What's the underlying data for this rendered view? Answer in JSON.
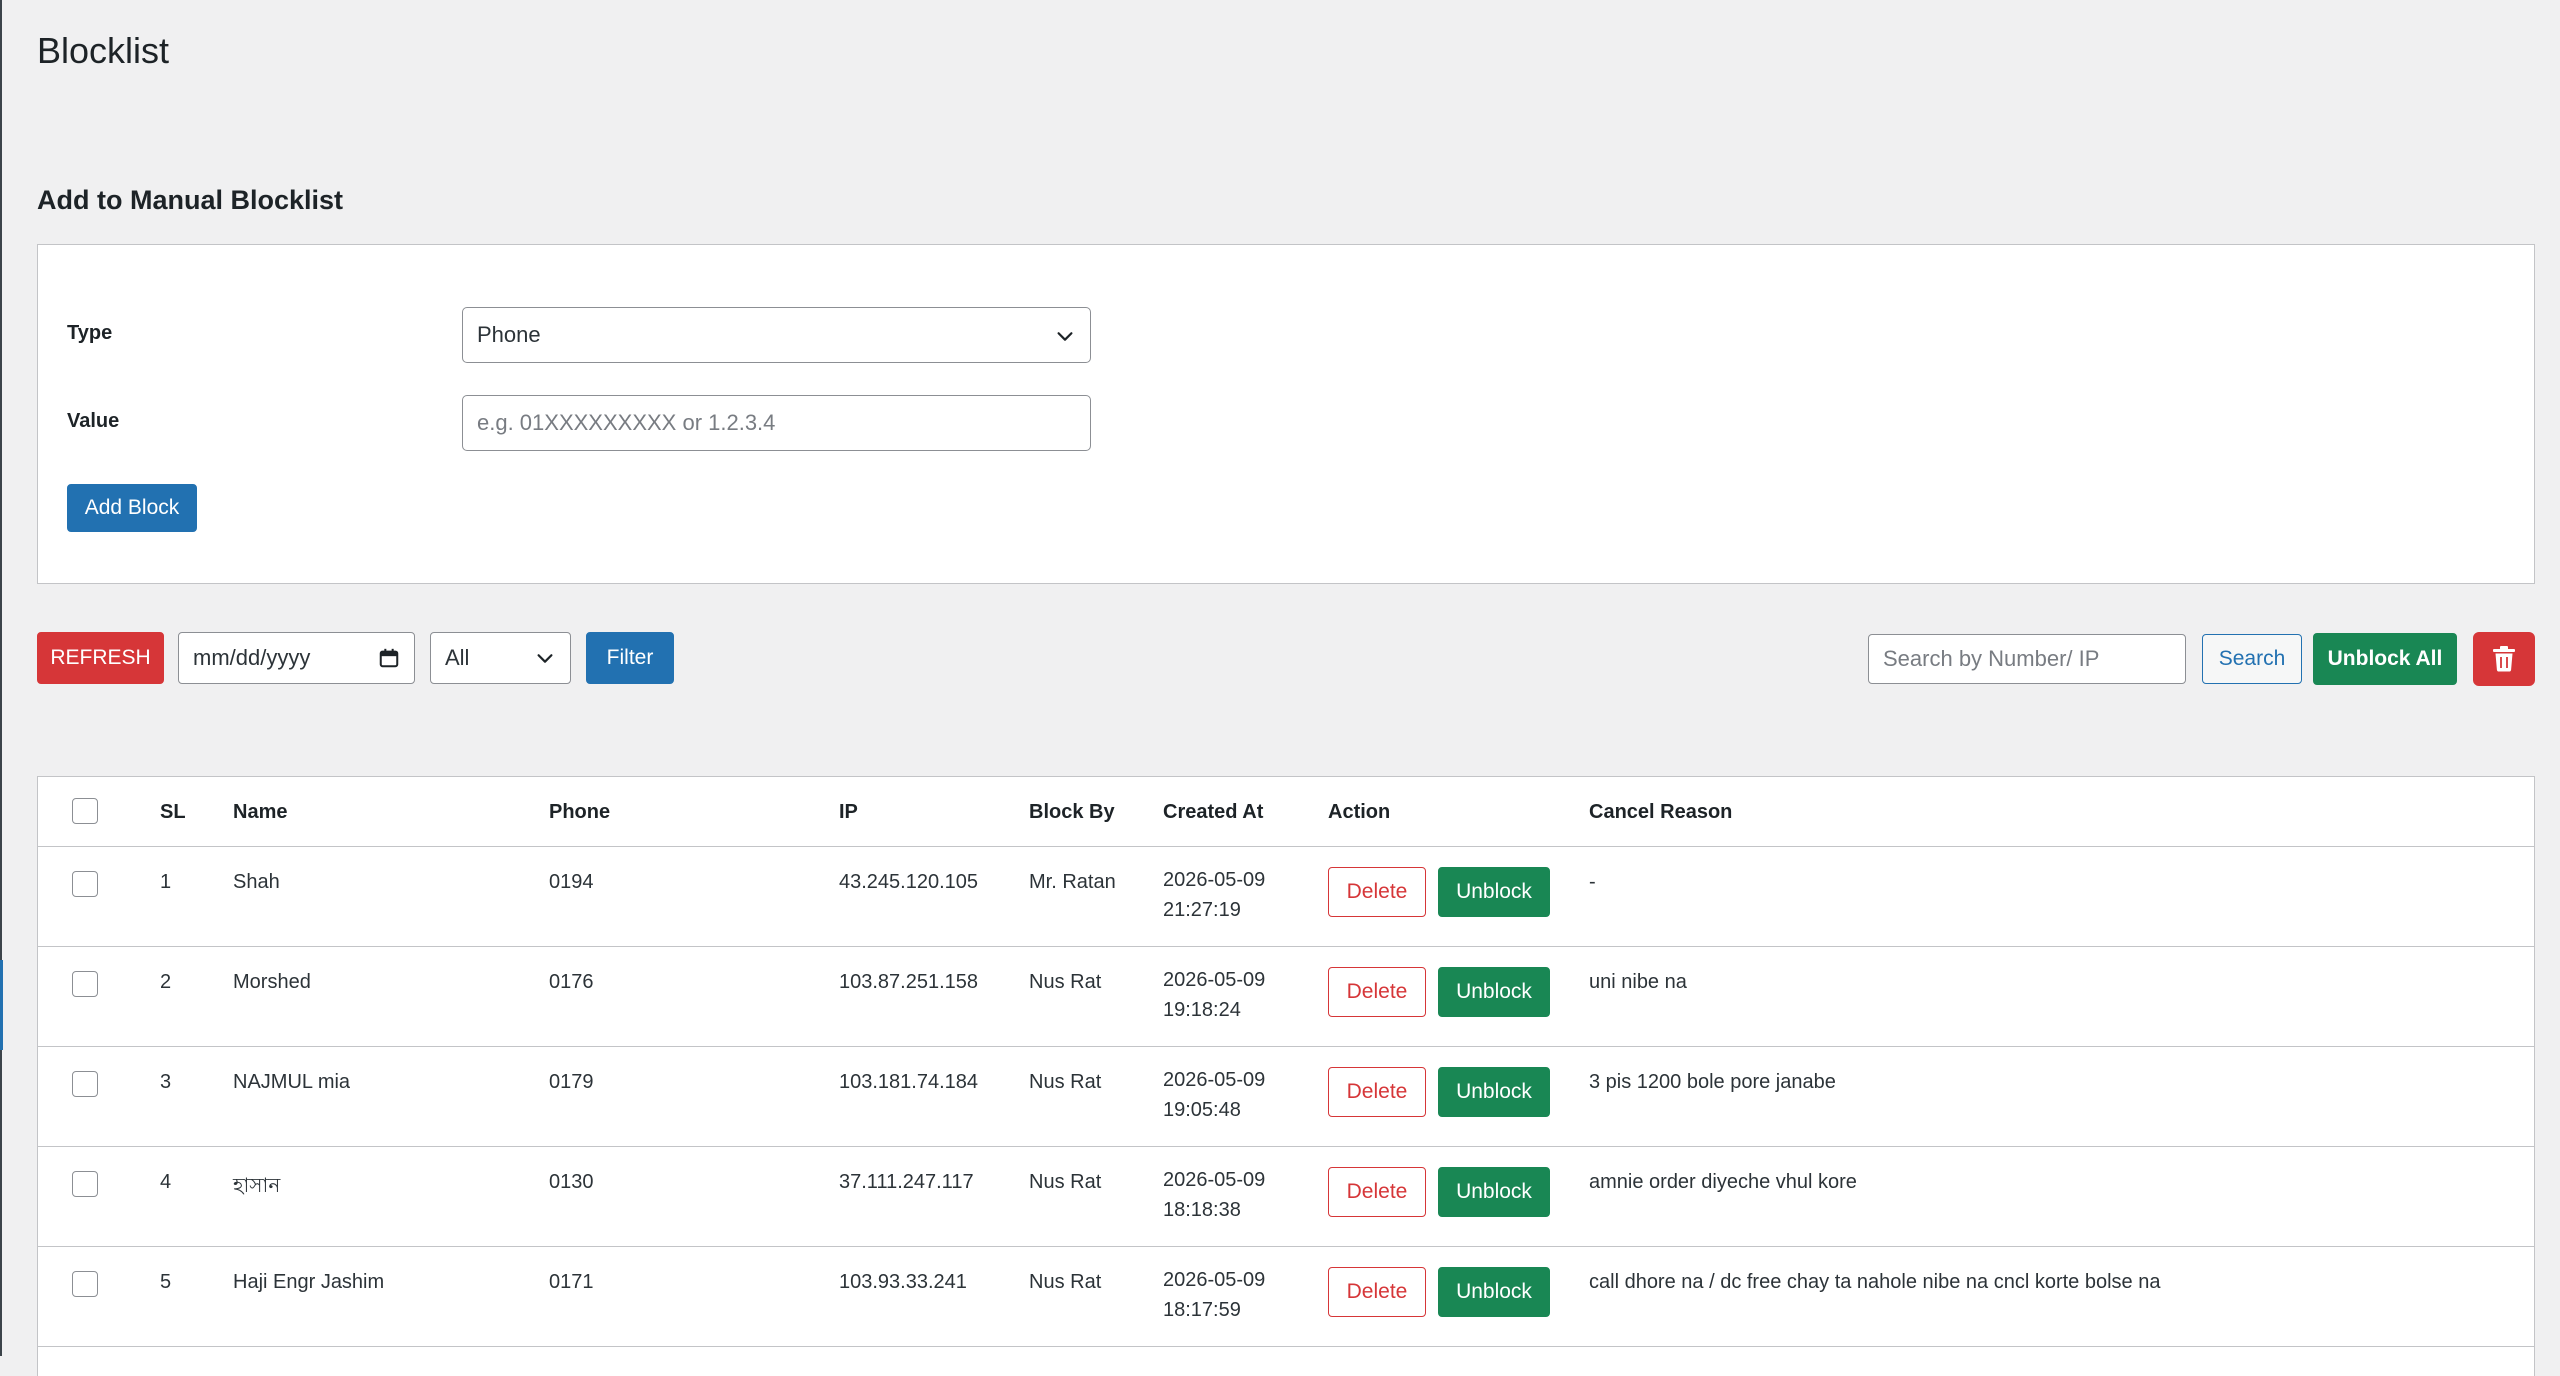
{
  "page": {
    "title": "Blocklist"
  },
  "manual": {
    "section_title": "Add to Manual Blocklist",
    "type_label": "Type",
    "type_value": "Phone",
    "value_label": "Value",
    "value_placeholder": "e.g. 01XXXXXXXXX or 1.2.3.4",
    "add_button": "Add Block"
  },
  "toolbar": {
    "refresh": "REFRESH",
    "date_placeholder": "mm/dd/yyyy",
    "status_value": "All",
    "filter": "Filter",
    "search_placeholder": "Search by Number/ IP",
    "search": "Search",
    "unblock_all": "Unblock All"
  },
  "table": {
    "headers": {
      "sl": "SL",
      "name": "Name",
      "phone": "Phone",
      "ip": "IP",
      "block_by": "Block By",
      "created_at": "Created At",
      "action": "Action",
      "cancel_reason": "Cancel Reason"
    },
    "delete_label": "Delete",
    "unblock_label": "Unblock",
    "rows": [
      {
        "sl": "1",
        "name": "Shah",
        "phone": "0194",
        "ip": "43.245.120.105",
        "block_by": "Mr. Ratan",
        "date": "2026-05-09",
        "time": "21:27:19",
        "reason": "-"
      },
      {
        "sl": "2",
        "name": "Morshed",
        "phone": "0176",
        "ip": "103.87.251.158",
        "block_by": "Nus Rat",
        "date": "2026-05-09",
        "time": "19:18:24",
        "reason": "uni nibe na"
      },
      {
        "sl": "3",
        "name": "NAJMUL mia",
        "phone": "0179",
        "ip": "103.181.74.184",
        "block_by": "Nus Rat",
        "date": "2026-05-09",
        "time": "19:05:48",
        "reason": "3 pis 1200 bole pore janabe"
      },
      {
        "sl": "4",
        "name": "হাসান",
        "phone": "0130",
        "ip": "37.111.247.117",
        "block_by": "Nus Rat",
        "date": "2026-05-09",
        "time": "18:18:38",
        "reason": "amnie order diyeche vhul kore"
      },
      {
        "sl": "5",
        "name": "Haji Engr Jashim",
        "phone": "0171",
        "ip": "103.93.33.241",
        "block_by": "Nus Rat",
        "date": "2026-05-09",
        "time": "18:17:59",
        "reason": "call dhore na / dc free chay ta nahole nibe na cncl korte bolse na"
      }
    ]
  }
}
